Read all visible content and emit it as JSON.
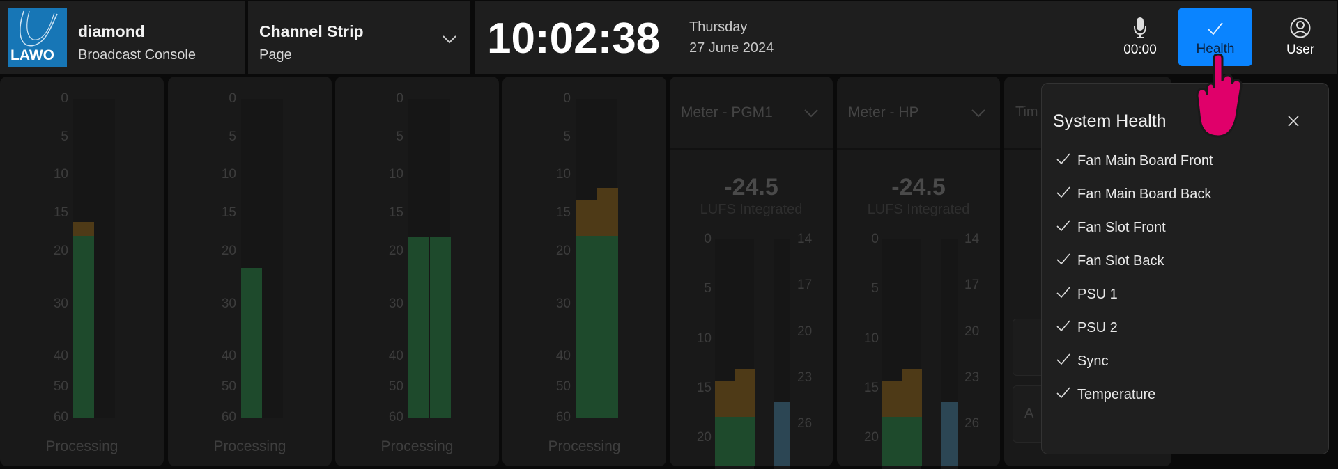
{
  "header": {
    "logo_text": "LAWO",
    "product": "diamond",
    "product_sub": "Broadcast Console",
    "page_selector": {
      "title": "Channel Strip",
      "sub": "Page"
    },
    "clock": {
      "time": "10:02:38",
      "day": "Thursday",
      "date": "27 June 2024"
    },
    "mic": {
      "icon": "microphone-icon",
      "timer": "00:00"
    },
    "health": {
      "icon": "check-icon",
      "label": "Health",
      "color": "#0a84ff"
    },
    "user": {
      "icon": "user-icon",
      "label": "User"
    }
  },
  "processing_strips": [
    {
      "label": "Processing",
      "bars": [
        {
          "peak": 16.2,
          "level": 18
        }
      ]
    },
    {
      "label": "Processing",
      "bars": [
        {
          "peak": 23.2,
          "level": 23.2
        }
      ]
    },
    {
      "label": "Processing",
      "bars": [
        {
          "peak": 18.1,
          "level": 18.1
        },
        {
          "peak": 18.1,
          "level": 18.1
        }
      ]
    },
    {
      "label": "Processing",
      "bars": [
        {
          "peak": 13.3,
          "level": 18
        },
        {
          "peak": 11.7,
          "level": 18
        }
      ]
    }
  ],
  "processing_scale": [
    "0",
    "5",
    "10",
    "15",
    "20",
    "30",
    "40",
    "50",
    "60"
  ],
  "meter_strips": [
    {
      "title": "Meter - PGM1",
      "value": "-24.5",
      "unit": "LUFS Integrated",
      "bars": [
        {
          "peak": 14.3,
          "level": 17.9
        },
        {
          "peak": 13.1,
          "level": 17.9
        }
      ],
      "loudness": 24.6
    },
    {
      "title": "Meter - HP",
      "value": "-24.5",
      "unit": "LUFS Integrated",
      "bars": [
        {
          "peak": 14.3,
          "level": 17.9
        },
        {
          "peak": 13.1,
          "level": 17.9
        }
      ],
      "loudness": 24.6
    }
  ],
  "meter_scale_left": [
    "0",
    "5",
    "10",
    "15",
    "20"
  ],
  "meter_scale_right": [
    "14",
    "17",
    "20",
    "23",
    "26"
  ],
  "partial_strip": {
    "title": "Tim",
    "button": "A"
  },
  "colors": {
    "green": "#1e4a2c",
    "orange": "#4e3a17",
    "blue": "#2c4654"
  },
  "system_health": {
    "title": "System Health",
    "items": [
      {
        "label": "Fan Main Board Front",
        "status": "ok"
      },
      {
        "label": "Fan Main Board Back",
        "status": "ok"
      },
      {
        "label": "Fan Slot Front",
        "status": "ok"
      },
      {
        "label": "Fan Slot Back",
        "status": "ok"
      },
      {
        "label": "PSU 1",
        "status": "ok"
      },
      {
        "label": "PSU 2",
        "status": "ok"
      },
      {
        "label": "Sync",
        "status": "ok"
      },
      {
        "label": "Temperature",
        "status": "ok"
      }
    ]
  }
}
